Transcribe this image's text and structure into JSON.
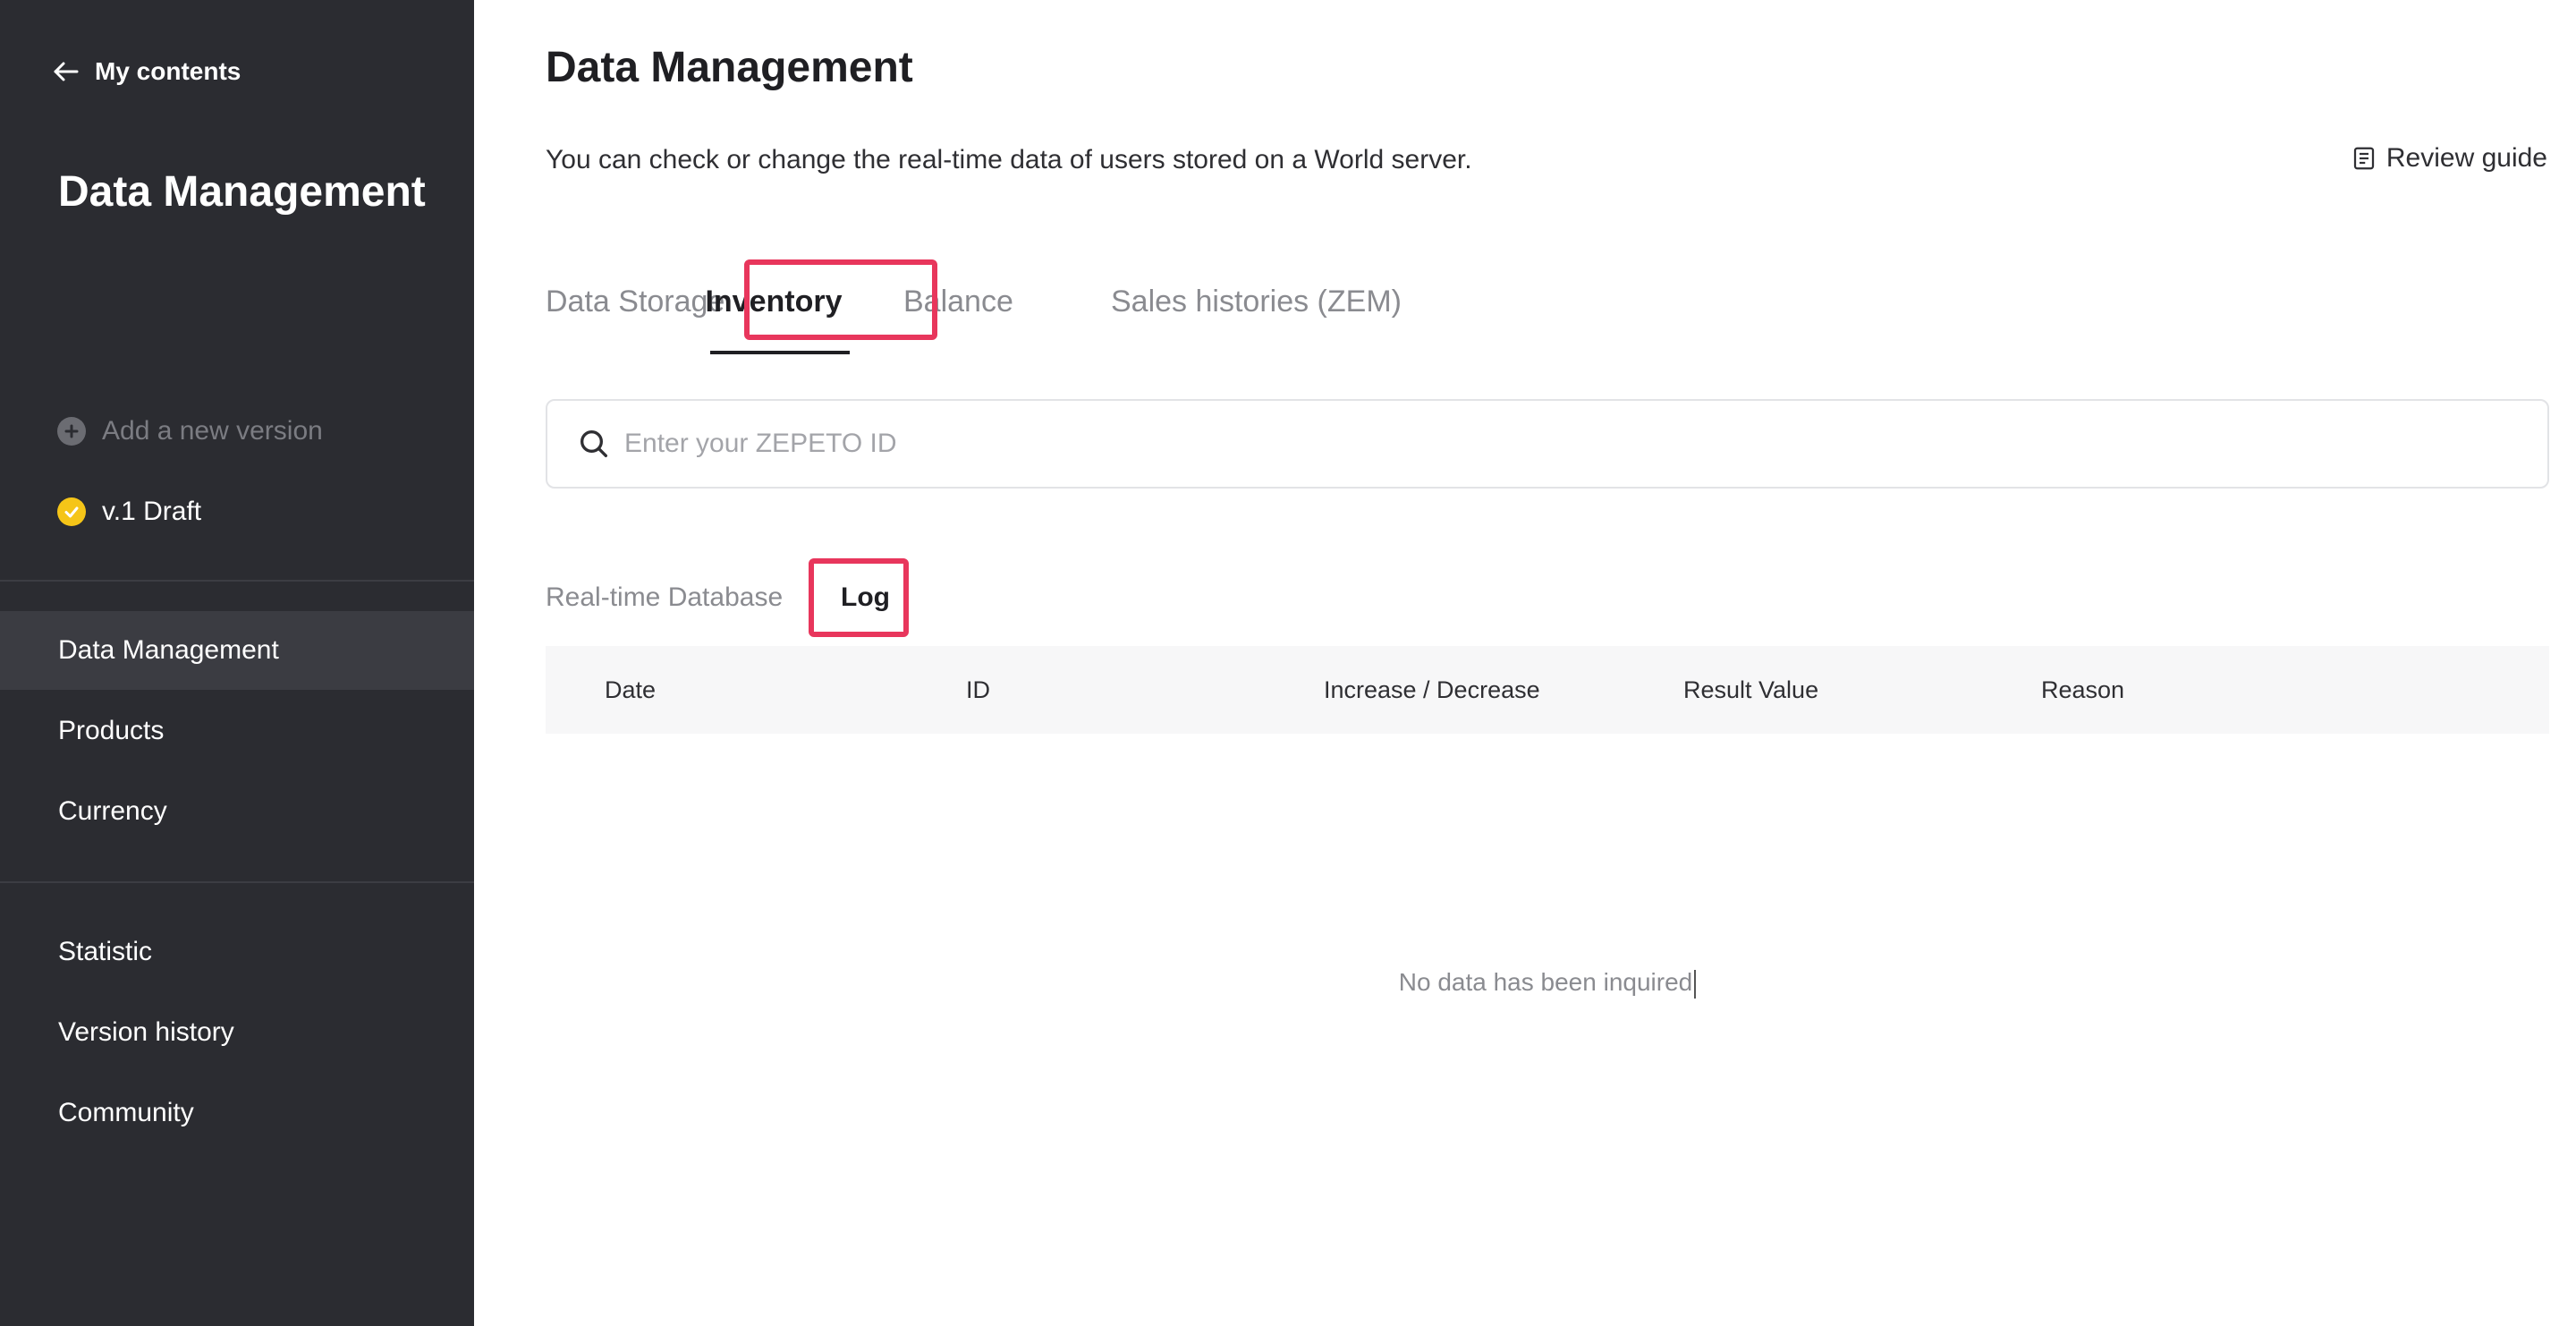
{
  "sidebar": {
    "back_label": "My contents",
    "title": "Data Management",
    "add_version_label": "Add a new version",
    "version_label": "v.1 Draft",
    "nav_items": [
      {
        "label": "Data Management",
        "active": true
      },
      {
        "label": "Products",
        "active": false
      },
      {
        "label": "Currency",
        "active": false
      },
      {
        "label": "Statistic",
        "active": false
      },
      {
        "label": "Version history",
        "active": false
      },
      {
        "label": "Community",
        "active": false
      }
    ]
  },
  "main": {
    "title": "Data Management",
    "description": "You can check or change the real-time data of users stored on a World server.",
    "review_guide_label": "Review guide",
    "tabs": [
      {
        "label": "Data Storage",
        "active": false
      },
      {
        "label": "Inventory",
        "active": true
      },
      {
        "label": "Balance",
        "active": false
      },
      {
        "label": "Sales histories (ZEM)",
        "active": false
      }
    ],
    "search": {
      "placeholder": "Enter your ZEPETO ID",
      "value": ""
    },
    "subtabs": [
      {
        "label": "Real-time Database",
        "active": false
      },
      {
        "label": "Log",
        "active": true
      }
    ],
    "table": {
      "columns": [
        "Date",
        "ID",
        "Increase / Decrease",
        "Result Value",
        "Reason"
      ],
      "rows": []
    },
    "empty_message": "No data has been inquired"
  },
  "colors": {
    "sidebar_bg": "#2b2c31",
    "sidebar_active": "#3b3c42",
    "highlight": "#e8365c",
    "draft_badge": "#f5c518",
    "table_header_bg": "#f7f7f8"
  },
  "icons": {
    "back": "arrow-left-icon",
    "add": "plus-circle-icon",
    "draft": "check-circle-icon",
    "guide": "document-icon",
    "search": "search-icon"
  }
}
